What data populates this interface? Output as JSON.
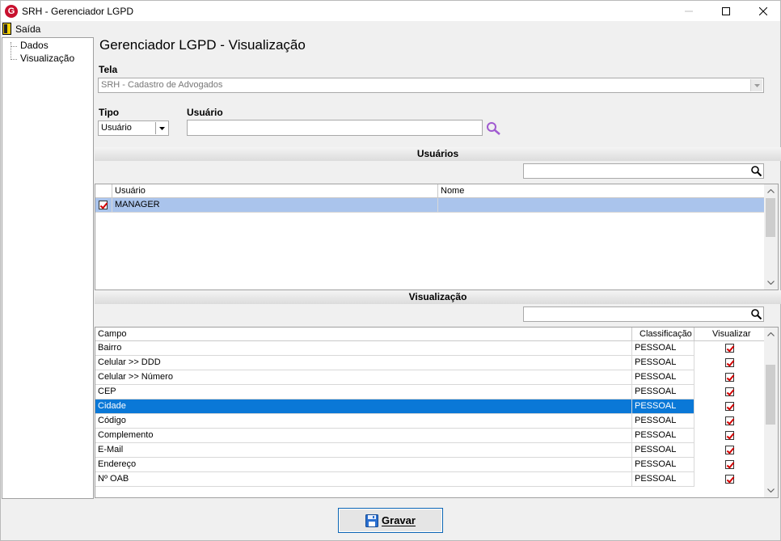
{
  "window": {
    "app_icon_letter": "G",
    "title": "SRH - Gerenciador LGPD"
  },
  "menu": {
    "exit_label": "Saída"
  },
  "tree": {
    "items": [
      {
        "label": "Dados"
      },
      {
        "label": "Visualização"
      }
    ]
  },
  "page": {
    "heading": "Gerenciador LGPD - Visualização",
    "tela_label": "Tela",
    "tela_value": "SRH - Cadastro de Advogados",
    "tipo_label": "Tipo",
    "tipo_value": "Usuário",
    "usuario_label": "Usuário",
    "usuario_value": ""
  },
  "usuarios": {
    "section_title": "Usuários",
    "search_value": "",
    "columns": [
      "Usuário",
      "Nome"
    ],
    "rows": [
      {
        "checked": true,
        "usuario": "MANAGER",
        "nome": ""
      }
    ]
  },
  "visualizacao": {
    "section_title": "Visualização",
    "search_value": "",
    "columns": [
      "Campo",
      "Classificação",
      "Visualizar"
    ],
    "rows": [
      {
        "campo": "Bairro",
        "classificacao": "PESSOAL",
        "visualizar": true
      },
      {
        "campo": "Celular >> DDD",
        "classificacao": "PESSOAL",
        "visualizar": true
      },
      {
        "campo": "Celular >> Número",
        "classificacao": "PESSOAL",
        "visualizar": true
      },
      {
        "campo": "CEP",
        "classificacao": "PESSOAL",
        "visualizar": true
      },
      {
        "campo": "Cidade",
        "classificacao": "PESSOAL",
        "visualizar": true
      },
      {
        "campo": "Código",
        "classificacao": "PESSOAL",
        "visualizar": true
      },
      {
        "campo": "Complemento",
        "classificacao": "PESSOAL",
        "visualizar": true
      },
      {
        "campo": "E-Mail",
        "classificacao": "PESSOAL",
        "visualizar": true
      },
      {
        "campo": "Endereço",
        "classificacao": "PESSOAL",
        "visualizar": true
      },
      {
        "campo": "Nº OAB",
        "classificacao": "PESSOAL",
        "visualizar": true
      }
    ],
    "selected_campo": "Cidade"
  },
  "footer": {
    "save_label": "Gravar"
  },
  "colors": {
    "selection_blue": "#0a78d7",
    "selection_light": "#aac4ec",
    "check_red": "#d40000",
    "search_purple": "#a05ad0"
  }
}
